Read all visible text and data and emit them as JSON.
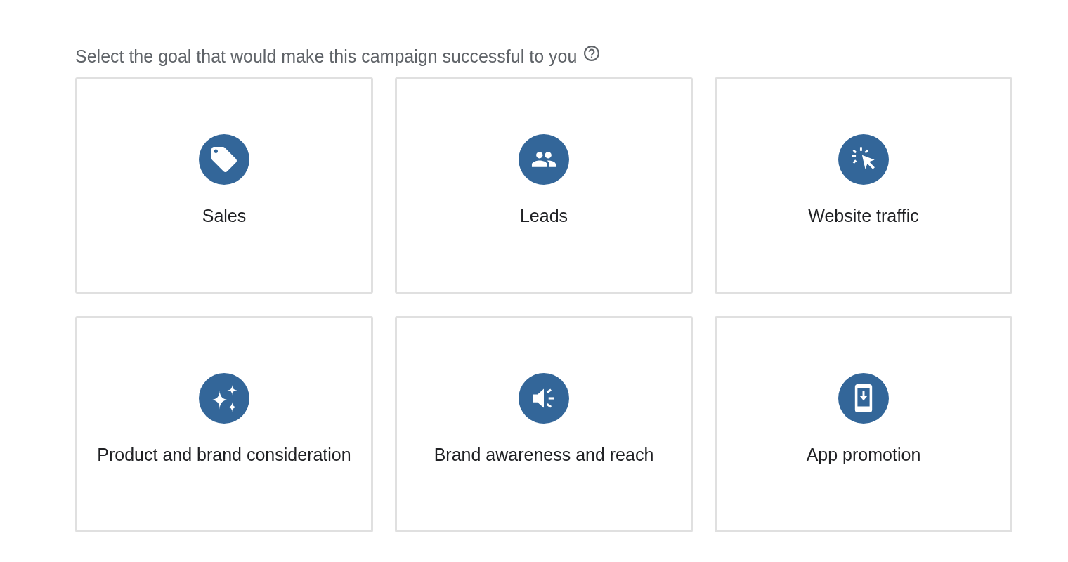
{
  "heading": {
    "text": "Select the goal that would make this campaign successful to you"
  },
  "goals": [
    {
      "label": "Sales",
      "kind": "tag",
      "selected": false
    },
    {
      "label": "Leads",
      "kind": "people",
      "selected": false
    },
    {
      "label": "Website traffic",
      "kind": "cursor",
      "selected": false
    },
    {
      "label": "Product and brand consideration",
      "kind": "sparkle",
      "selected": false
    },
    {
      "label": "Brand awareness and reach",
      "kind": "speaker",
      "selected": false
    },
    {
      "label": "App promotion",
      "kind": "phone",
      "selected": false
    }
  ]
}
